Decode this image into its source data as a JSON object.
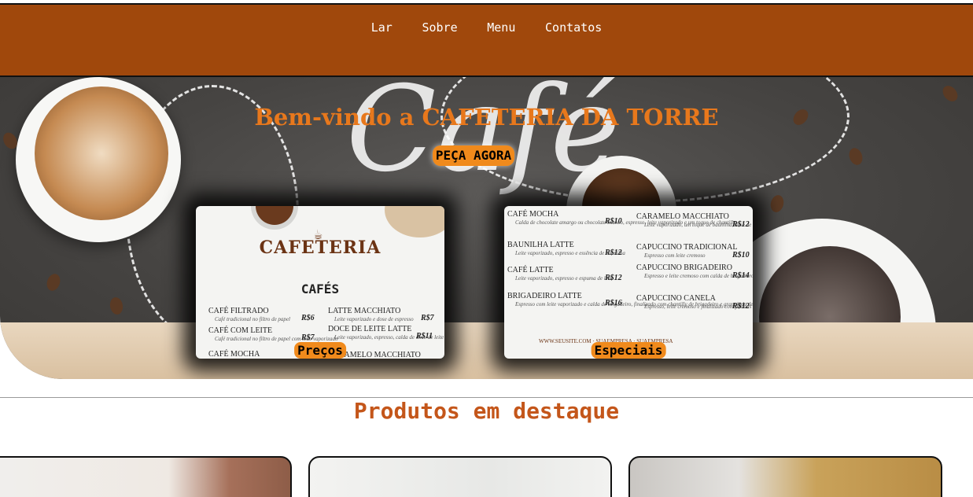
{
  "nav": {
    "links": [
      "Lar",
      "Sobre",
      "Menu",
      "Contatos"
    ]
  },
  "hero": {
    "title": "Bem-vindo a CAFETERIA DA TORRE",
    "order_button": "PEÇA AGORA",
    "background_script_text": "Café",
    "cards": [
      {
        "label": "Preços",
        "brand": "CAFETERIA",
        "section": "CAFÉS",
        "items_left": [
          {
            "name": "CAFÉ FILTRADO",
            "desc": "Café tradicional no filtro de papel",
            "price": "R$6"
          },
          {
            "name": "CAFÉ COM LEITE",
            "desc": "Café tradicional no filtro de papel com leite vaporizado",
            "price": "R$7"
          },
          {
            "name": "CAFÉ MOCHA",
            "desc": "",
            "price": ""
          }
        ],
        "items_right": [
          {
            "name": "LATTE MACCHIATO",
            "desc": "Leite vaporizado e dose de espresso",
            "price": "R$7"
          },
          {
            "name": "DOCE DE LEITE LATTE",
            "desc": "Leite vaporizado, espresso, calda de doce de leite",
            "price": "R$11"
          },
          {
            "name": "CARAMELO MACCHIATO",
            "desc": "",
            "price": ""
          }
        ]
      },
      {
        "label": "Especiais",
        "items_left": [
          {
            "name": "CAFÉ MOCHA",
            "desc": "Calda de chocolate amargo ou chocolate branco, espresso, leite vaporizado e um toque de chantilly",
            "price": "R$10"
          },
          {
            "name": "BAUNILHA LATTE",
            "desc": "Leite vaporizado, espresso e essência de baunilha",
            "price": "R$12"
          },
          {
            "name": "CAFÉ LATTE",
            "desc": "Leite vaporizado, espresso e espuma de leite",
            "price": "R$12"
          },
          {
            "name": "BRIGADEIRO LATTE",
            "desc": "Espresso com leite vaporizado e calda de brigadeiro, finalizado com chantilly de brigadeiro e granulado de chocolate",
            "price": "R$16"
          }
        ],
        "items_right": [
          {
            "name": "CARAMELO MACCHIATO",
            "desc": "Leite vaporizado, um toque de baunilha, dose de espresso e cobertura de caramelo",
            "price": "R$12"
          },
          {
            "name": "CAPUCCINO TRADICIONAL",
            "desc": "Espresso com leite cremoso",
            "price": "R$10"
          },
          {
            "name": "CAPUCCINO BRIGADEIRO",
            "desc": "Espresso e leite cremoso com calda de brigadeiro e granulado de chocolate belga ao leite",
            "price": "R$14"
          },
          {
            "name": "CAPUCCINO CANELA",
            "desc": "Espresso, leite cremoso e finalizado com pitadas de canela em pó",
            "price": "R$12"
          }
        ],
        "footer": "WWW.SEUSITE.COM · SUAEMPRESA · SUAEMPRESA"
      }
    ]
  },
  "featured": {
    "title": "Produtos em destaque"
  },
  "colors": {
    "nav_bg": "#a0480c",
    "accent": "#f08a1c",
    "title_orange": "#e8781c",
    "section_title": "#c4561a"
  }
}
